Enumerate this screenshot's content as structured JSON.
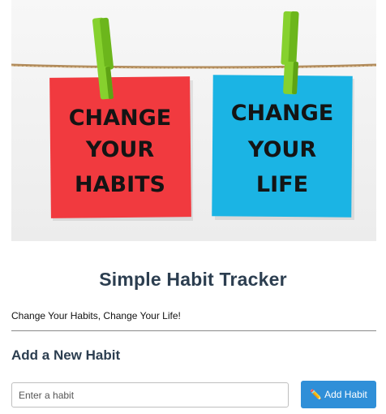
{
  "hero": {
    "notes": [
      {
        "lines": [
          "CHANGE",
          "YOUR",
          "HABITS"
        ],
        "color": "#f13a3f"
      },
      {
        "lines": [
          "CHANGE",
          "YOUR",
          "LIFE"
        ],
        "color": "#1bb4e4"
      }
    ],
    "clip_color": "#86d12e"
  },
  "app": {
    "title": "Simple Habit Tracker",
    "tagline": "Change Your Habits, Change Your Life!"
  },
  "add_habit": {
    "heading": "Add a New Habit",
    "input_placeholder": "Enter a habit",
    "input_value": "",
    "button_icon": "pencil-icon",
    "button_label": "Add Habit",
    "button_color": "#2f8fd8"
  }
}
